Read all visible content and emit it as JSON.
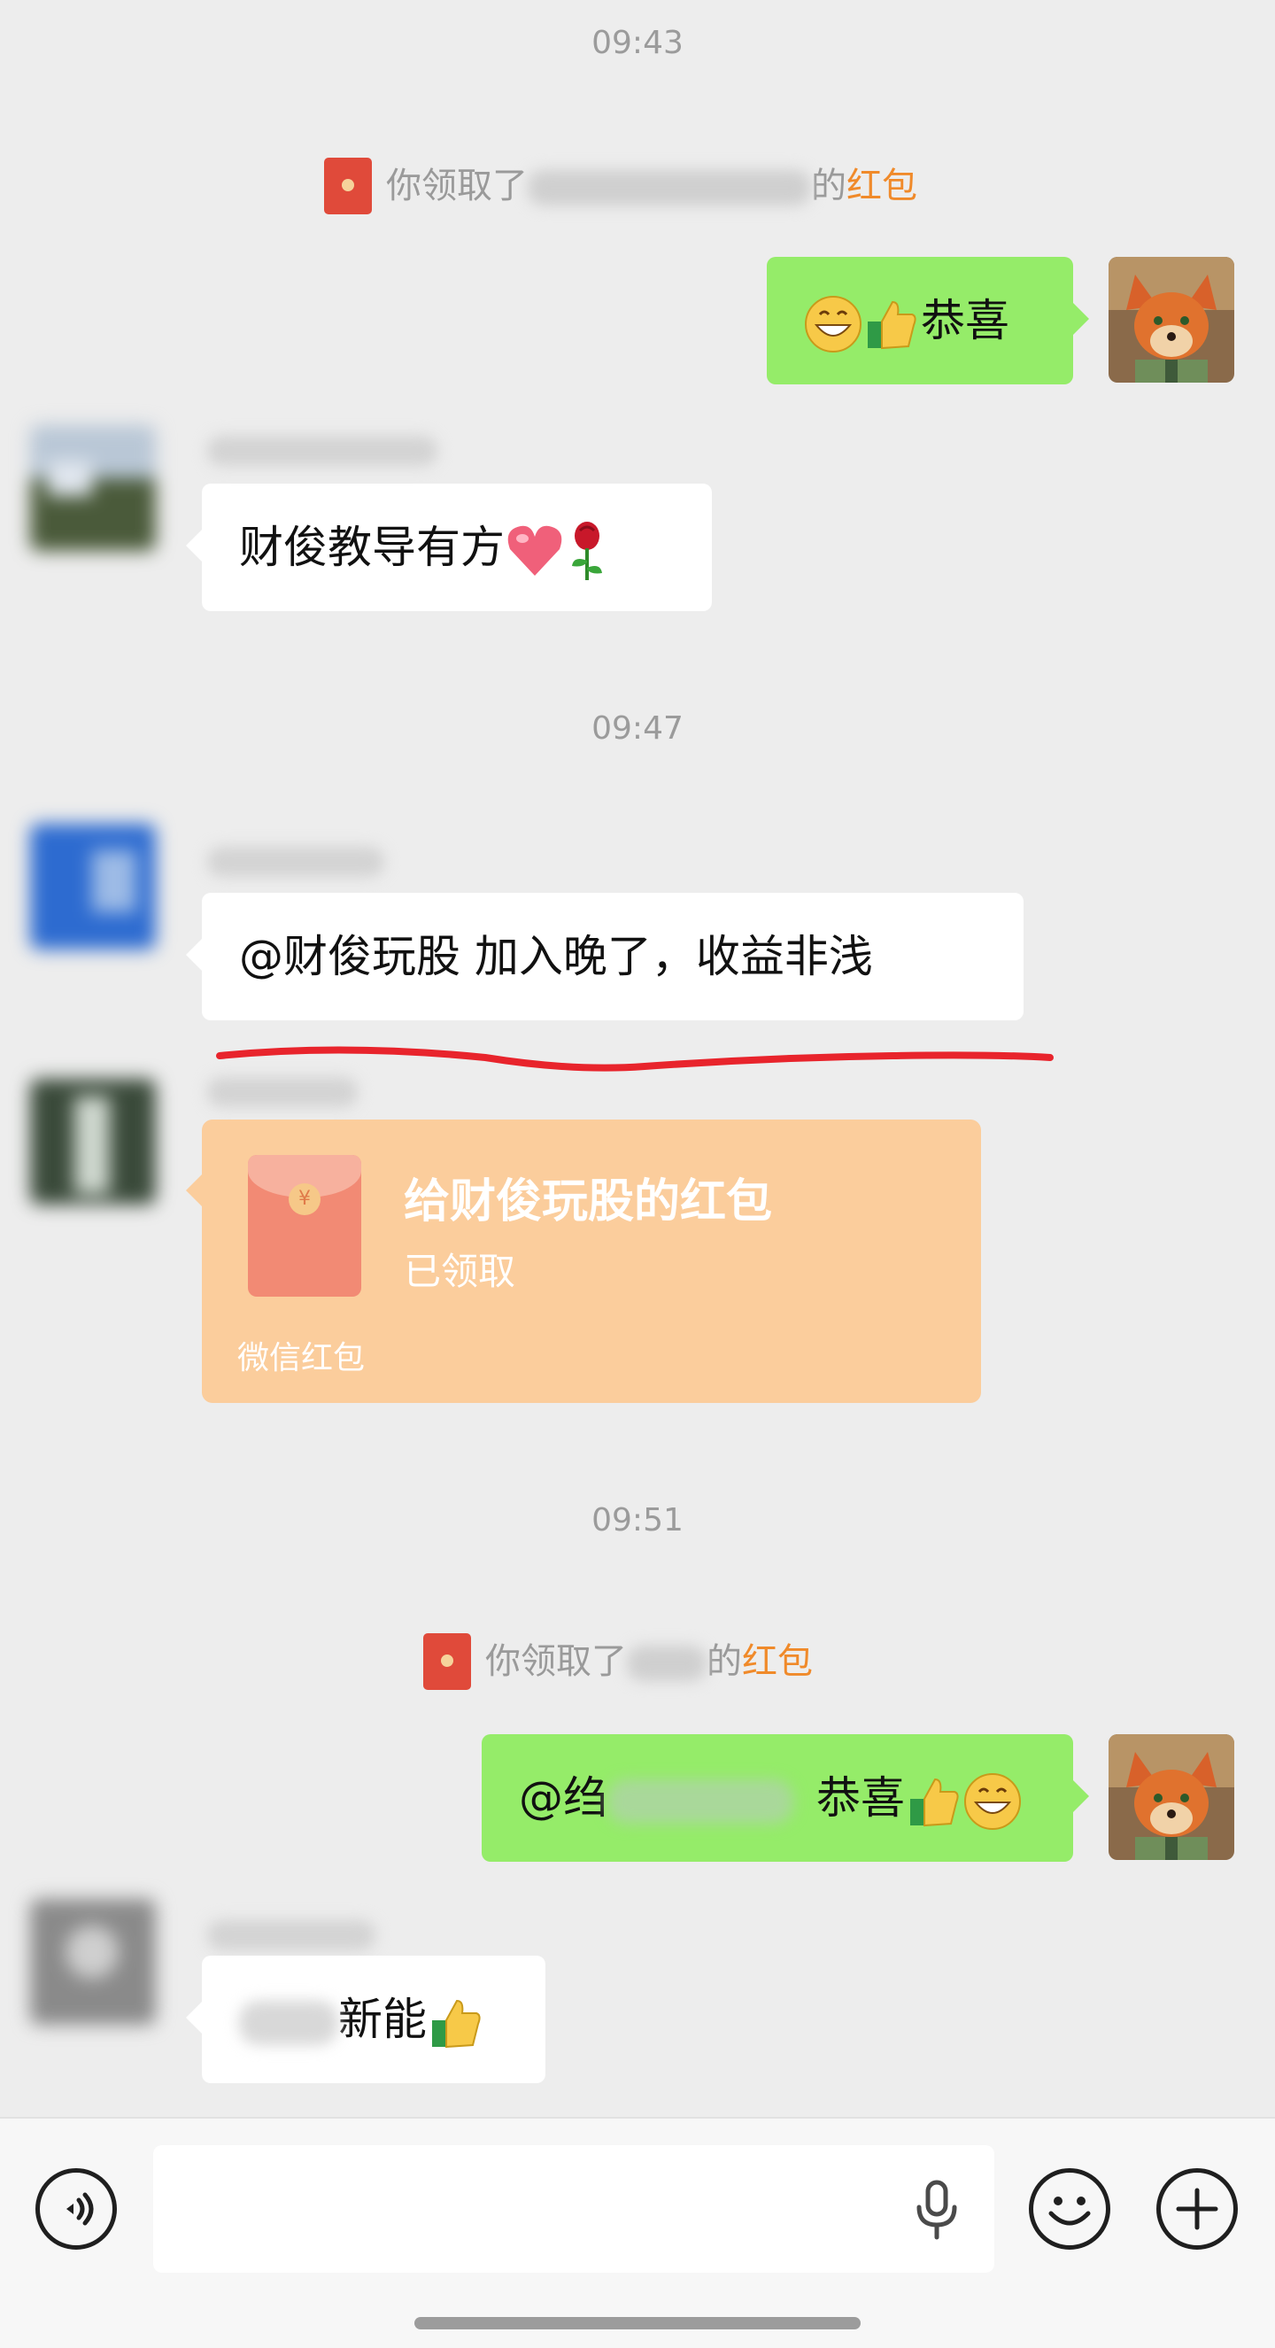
{
  "times": [
    "09:43",
    "09:47",
    "09:51"
  ],
  "system": [
    {
      "prefix": "你领取了",
      "suffix": "的",
      "link": "红包"
    },
    {
      "prefix": "你领取了",
      "suffix": "的",
      "link": "红包"
    }
  ],
  "messages": {
    "m1": "恭喜",
    "m2": "财俊教导有方",
    "m3": "@财俊玩股  加入晚了，收益非浅",
    "m5_prefix": "@绉",
    "m5_text": "恭喜",
    "m6": "新能"
  },
  "redpacket": {
    "title": "给财俊玩股的红包",
    "status": "已领取",
    "footer": "微信红包",
    "coin": "¥"
  },
  "input": {
    "placeholder": ""
  },
  "colors": {
    "background": "#ededed",
    "bubble_self": "#95ec69",
    "bubble_other": "#ffffff",
    "red_link": "#f08a2a",
    "redpacket": "#fbcd9c",
    "underline_annotation": "#e8242c"
  },
  "icons": [
    "red-packet-icon",
    "grinning-emoji",
    "thumbs-up-emoji",
    "heart-emoji",
    "rose-emoji",
    "voice-toggle-icon",
    "microphone-icon",
    "emoji-icon",
    "plus-icon"
  ]
}
